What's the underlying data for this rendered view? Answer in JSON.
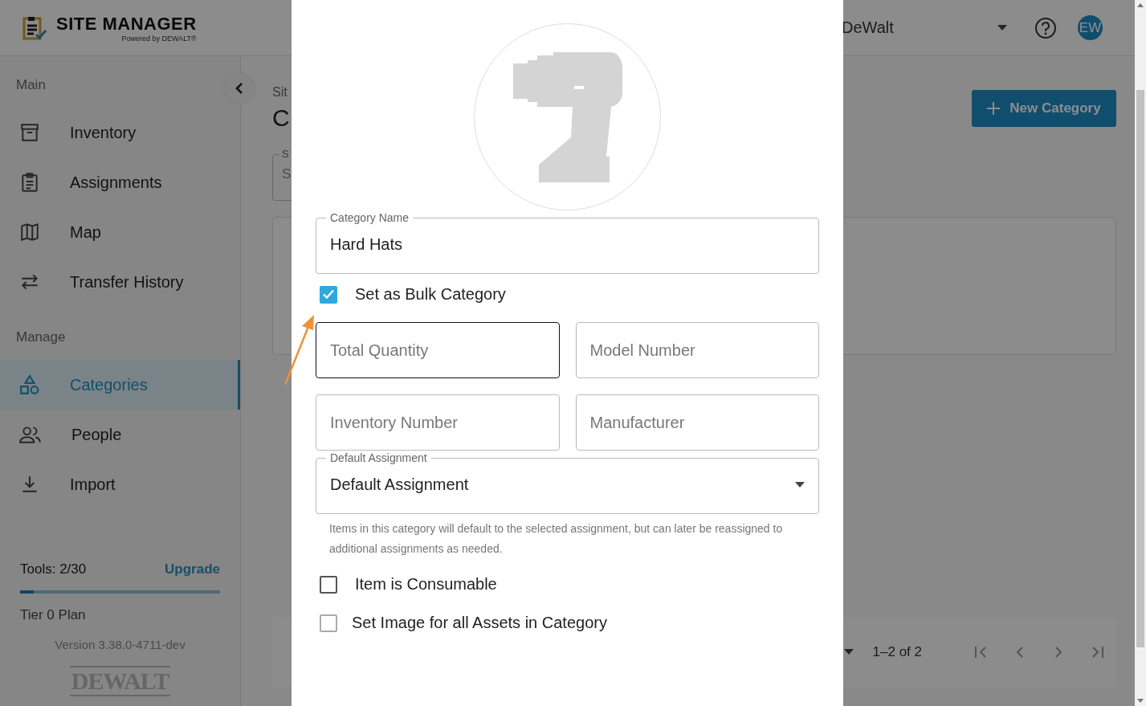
{
  "header": {
    "title": "SITE MANAGER",
    "subtitle": "Powered by DEWALT®",
    "organization": "DeWalt",
    "avatar": "EW"
  },
  "sidebar": {
    "sections": [
      {
        "title": "Main",
        "items": [
          {
            "label": "Inventory",
            "selected": false
          },
          {
            "label": "Assignments",
            "selected": false
          },
          {
            "label": "Map",
            "selected": false
          },
          {
            "label": "Transfer History",
            "selected": false
          }
        ]
      },
      {
        "title": "Manage",
        "items": [
          {
            "label": "Categories",
            "selected": true
          },
          {
            "label": "People",
            "selected": false
          },
          {
            "label": "Import",
            "selected": false
          }
        ]
      }
    ],
    "plan": {
      "usage": "Tools: 2/30",
      "upgrade": "Upgrade",
      "level": 0.067,
      "tier": "Tier 0 Plan",
      "version": "Version 3.38.0-4711-dev",
      "brand": "DEWALT"
    }
  },
  "main": {
    "breadcrumb": "Sit",
    "title": "C",
    "search": {
      "label": "S",
      "placeholder": "S"
    },
    "new_button": "New Category",
    "pagination": {
      "range": "1–2 of 2"
    }
  },
  "dialog": {
    "name_field": {
      "label": "Category Name",
      "value": "Hard Hats"
    },
    "bulk": {
      "label": "Set as Bulk Category",
      "checked": true
    },
    "fields": [
      {
        "placeholder": "Total Quantity",
        "focused": true
      },
      {
        "placeholder": "Model Number",
        "focused": false
      },
      {
        "placeholder": "Inventory Number",
        "focused": false
      },
      {
        "placeholder": "Manufacturer",
        "focused": false
      }
    ],
    "assignment": {
      "label": "Default Assignment",
      "value": "Default Assignment"
    },
    "assignment_help": "Items in this category will default to the selected assignment, but can later be reassigned to additional assignments as needed.",
    "options": [
      {
        "label": "Item is Consumable",
        "checked": false
      },
      {
        "label": "Set Image for all Assets in Category",
        "checked": false
      }
    ]
  }
}
